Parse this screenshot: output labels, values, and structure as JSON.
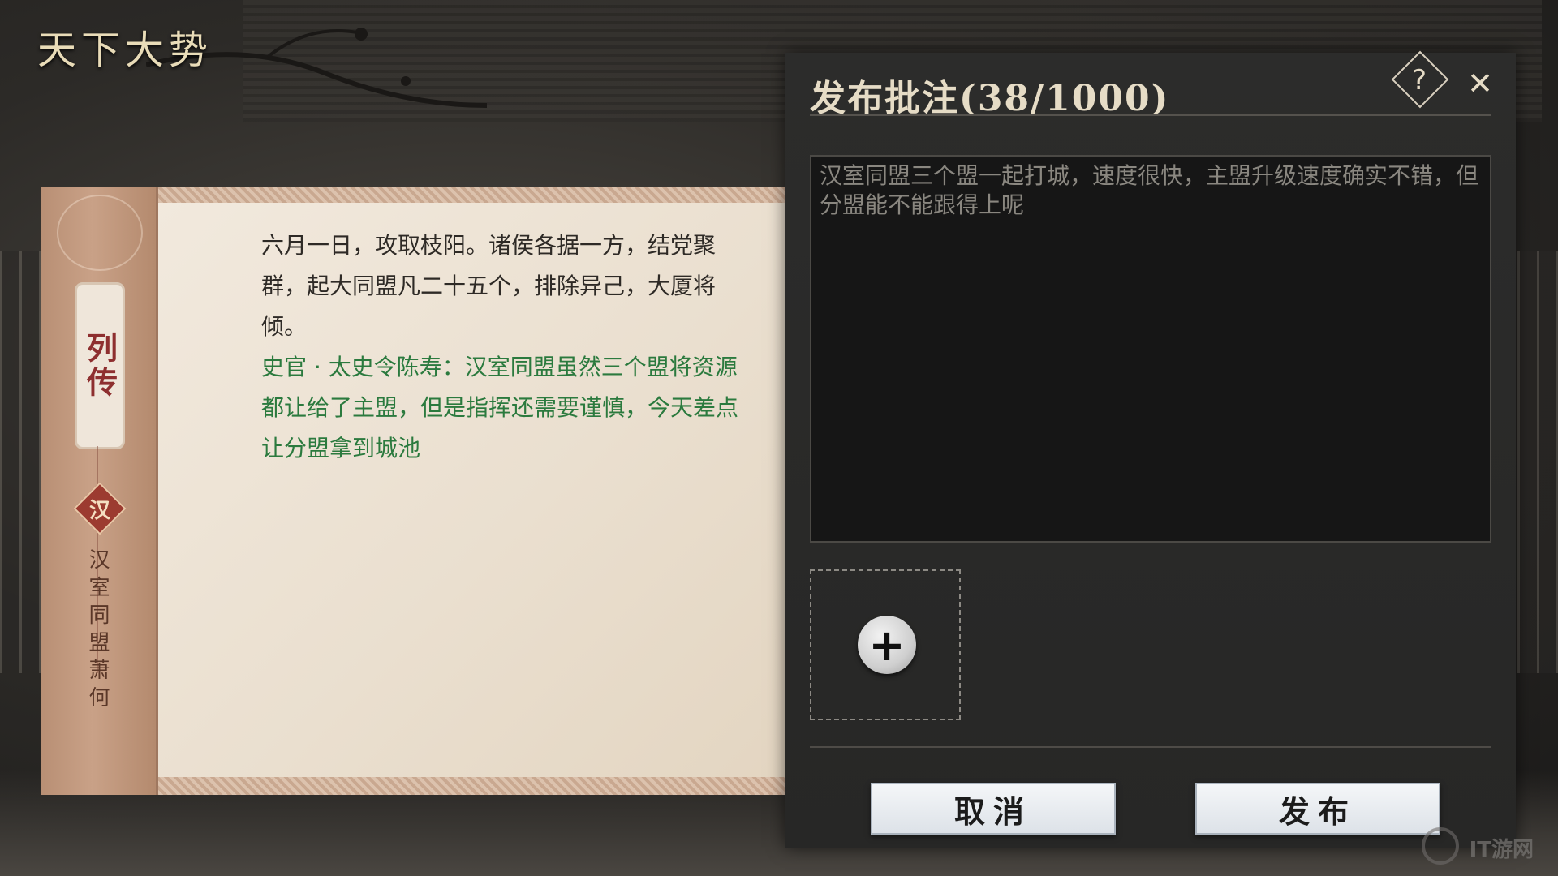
{
  "page": {
    "title": "天下大势"
  },
  "scroll": {
    "tag": "列传",
    "faction": "汉",
    "alliance_name": "汉室同盟萧何",
    "event_text": "六月一日，攻取枝阳。诸侯各据一方，结党聚群，起大同盟凡二十五个，排除异己，大厦将倾。",
    "annotation_text": "史官 · 太史令陈寿：汉室同盟虽然三个盟将资源都让给了主盟，但是指挥还需要谨慎，今天差点让分盟拿到城池"
  },
  "dialog": {
    "title": "发布批注(38/1000)",
    "help_symbol": "?",
    "close_symbol": "✕",
    "comment_value": "汉室同盟三个盟一起打城，速度很快，主盟升级速度确实不错，但分盟能不能跟得上呢",
    "add_symbol": "+",
    "cancel_label": "取消",
    "publish_label": "发布"
  },
  "icons": {
    "help": "help-icon",
    "close": "close-icon",
    "add_image": "plus-icon"
  },
  "watermark": {
    "text": "IT游网"
  },
  "colors": {
    "annotation_green": "#2b7a3e",
    "seal_red": "#9c3b30",
    "title_gold": "#e6dcc6"
  }
}
